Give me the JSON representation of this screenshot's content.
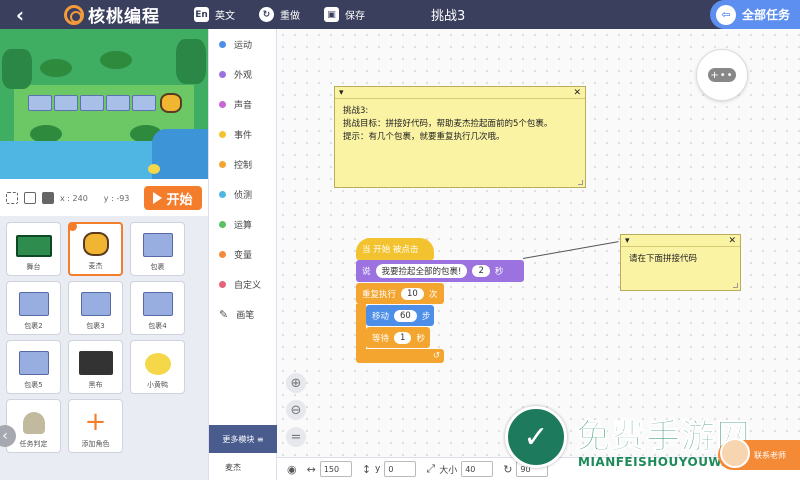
{
  "topbar": {
    "back_glyph": "‹",
    "brand": "核桃编程",
    "english_icon": "En",
    "english_label": "英文",
    "redo_icon": "↻",
    "redo_label": "重做",
    "save_icon": "▣",
    "save_label": "保存",
    "challenge_title": "挑战3",
    "all_tasks_icon": "⇦",
    "all_tasks_label": "全部任务"
  },
  "stage_controls": {
    "x_label": "x : 240",
    "y_label": "y : -93",
    "start_label": "开始"
  },
  "sprites": [
    {
      "label": "舞台",
      "thumb": "stage-t"
    },
    {
      "label": "麦杰",
      "thumb": "hero-t",
      "selected": true
    },
    {
      "label": "包裹",
      "thumb": "box-t"
    },
    {
      "label": "包裹2",
      "thumb": "box-t"
    },
    {
      "label": "包裹3",
      "thumb": "box-t"
    },
    {
      "label": "包裹4",
      "thumb": "box-t"
    },
    {
      "label": "包裹5",
      "thumb": "box-t"
    },
    {
      "label": "黑布",
      "thumb": "canvas-t"
    },
    {
      "label": "小黄鸭",
      "thumb": "duck-t"
    },
    {
      "label": "任务判定",
      "thumb": "judge-t"
    },
    {
      "label": "添加角色",
      "thumb": "add"
    }
  ],
  "categories": [
    {
      "label": "运动",
      "color": "#4d8ee8"
    },
    {
      "label": "外观",
      "color": "#9b72e0"
    },
    {
      "label": "声音",
      "color": "#c866d6"
    },
    {
      "label": "事件",
      "color": "#f3c32f"
    },
    {
      "label": "控制",
      "color": "#f3a52f"
    },
    {
      "label": "侦测",
      "color": "#4fb6e3"
    },
    {
      "label": "运算",
      "color": "#5cbf64"
    },
    {
      "label": "变量",
      "color": "#f58a3a"
    },
    {
      "label": "自定义",
      "color": "#e6647a"
    },
    {
      "label": "画笔",
      "icon": "pencil-icon"
    }
  ],
  "more_modules": "更多模块 ≡",
  "current_sprite": "麦杰",
  "note_main": {
    "line1": "挑战3:",
    "line2": "挑战目标：拼接好代码，帮助麦杰捡起面前的5个包裹。",
    "line3": "提示：有几个包裹，就要重复执行几次哦。"
  },
  "note_side": {
    "text": "请在下面拼接代码"
  },
  "blocks": {
    "event": "当  开始  被点击",
    "say_label": "说",
    "say_text": "我要捡起全部的包裹!",
    "say_secs": "2",
    "say_unit": "秒",
    "repeat_label": "重复执行",
    "repeat_count": "10",
    "repeat_unit": "次",
    "move_label": "移动",
    "move_steps": "60",
    "move_unit": "步",
    "wait_label": "等待",
    "wait_secs": "1",
    "wait_unit": "秒"
  },
  "bottombar": {
    "x_value": "150",
    "y_label": "y",
    "y_value": "0",
    "size_label": "大小",
    "size_value": "40",
    "dir_value": "90"
  },
  "watermark": {
    "logo_glyph": "✓",
    "title": "免费手游网",
    "subtitle": "MIANFEISHOUYOUWANG"
  },
  "teacher_label": "联系老师"
}
